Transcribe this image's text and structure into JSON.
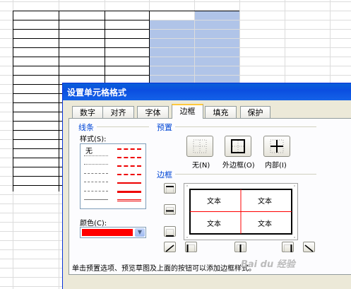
{
  "dialog": {
    "title": "设置单元格格式"
  },
  "tabs": [
    {
      "label": "数字"
    },
    {
      "label": "对齐"
    },
    {
      "label": "字体"
    },
    {
      "label": "边框",
      "active": true
    },
    {
      "label": "填充"
    },
    {
      "label": "保护"
    }
  ],
  "line": {
    "section_label": "线条",
    "style_label": "样式(S):",
    "none_option": "无",
    "color_label": "颜色(C):",
    "color_value": "#ff0000"
  },
  "presets": {
    "section_label": "预置",
    "none_label": "无(N)",
    "outline_label": "外边框(O)",
    "inside_label": "内部(I)"
  },
  "border": {
    "section_label": "边框",
    "preview_cells": [
      "文本",
      "文本",
      "文本",
      "文本"
    ]
  },
  "hint": "单击预置选项、预览草图及上面的按钮可以添加边框样式。",
  "watermark": "Bai du 经验",
  "colors": {
    "accent_selection": "#b0c4e8",
    "title_bar": "#0b4ee0",
    "preview_lines": "#ff0000"
  }
}
